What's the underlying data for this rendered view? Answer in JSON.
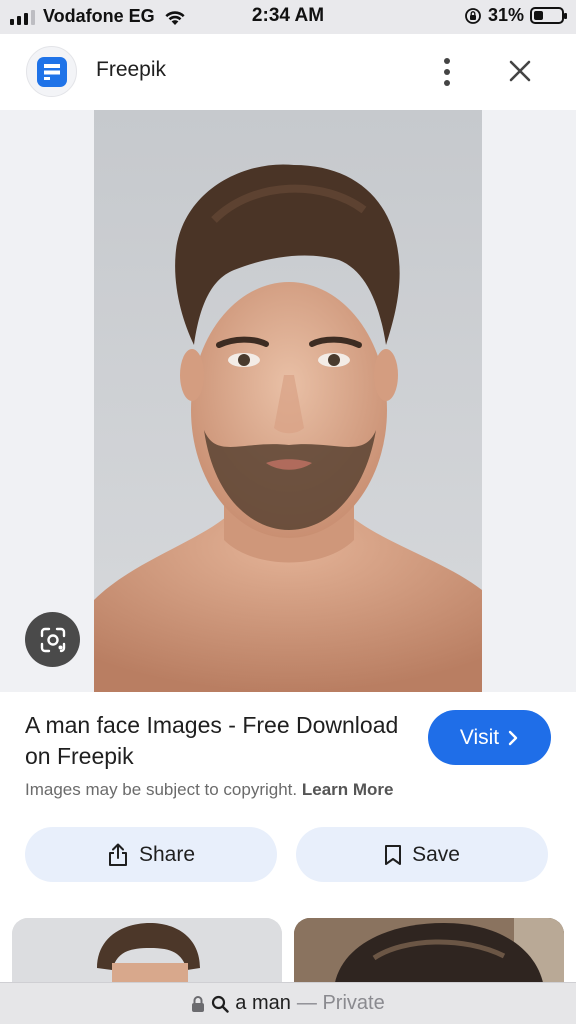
{
  "status_bar": {
    "carrier": "Vodafone EG",
    "time": "2:34 AM",
    "battery_percent": "31%",
    "battery_level": 0.31
  },
  "header": {
    "site_name": "Freepik",
    "logo_icon": "freepik-logo-icon",
    "more_icon": "more-vertical-icon",
    "close_icon": "close-icon"
  },
  "result": {
    "title": "A man face Images - Free Download on Freepik",
    "visit_label": "Visit",
    "copyright_text": "Images may be subject to copyright.",
    "learn_more": "Learn More"
  },
  "actions": {
    "share_label": "Share",
    "save_label": "Save"
  },
  "url_bar": {
    "query": "a man",
    "mode": "— Private"
  },
  "colors": {
    "accent": "#1f6ee8",
    "action_bg": "#e8effb"
  }
}
